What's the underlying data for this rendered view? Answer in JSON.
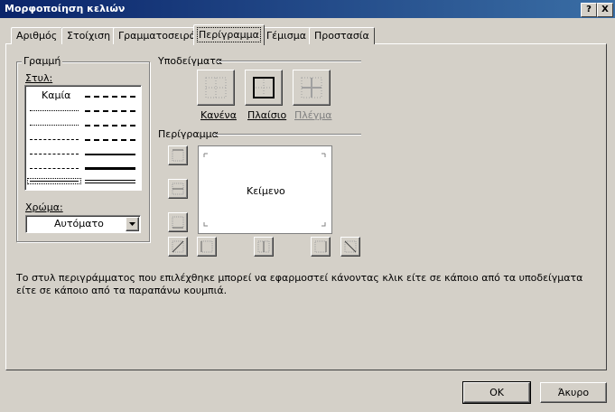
{
  "dialog": {
    "title": "Μορφοποίηση κελιών",
    "help_glyph": "?",
    "close_glyph": "X"
  },
  "tabs": [
    {
      "label": "Αριθμός"
    },
    {
      "label": "Στοίχιση"
    },
    {
      "label": "Γραμματοσειρά"
    },
    {
      "label": "Περίγραμμα",
      "active": true
    },
    {
      "label": "Γέμισμα"
    },
    {
      "label": "Προστασία"
    }
  ],
  "line": {
    "group_label": "Γραμμή",
    "style_label": "Στυλ:",
    "none_style": "Καμία",
    "color_label": "Χρώμα:",
    "color_value": "Αυτόματο"
  },
  "presets": {
    "label": "Υποδείγματα",
    "items": [
      {
        "label": "Κανένα",
        "enabled": true
      },
      {
        "label": "Πλαίσιο",
        "enabled": true
      },
      {
        "label": "Πλέγμα",
        "enabled": false
      }
    ]
  },
  "border": {
    "label": "Περίγραμμα",
    "preview_text": "Κείμενο"
  },
  "hint": "Το στυλ περιγράμματος που επιλέχθηκε μπορεί να εφαρμοστεί κάνοντας κλικ είτε σε κάποιο από τα υποδείγματα είτε σε κάποιο από τα παραπάνω κουμπιά.",
  "buttons": {
    "ok": "OK",
    "cancel": "Άκυρο"
  },
  "colors": {
    "titlebar_start": "#0a246a",
    "titlebar_end": "#3a6ea5",
    "face": "#d4d0c8"
  }
}
